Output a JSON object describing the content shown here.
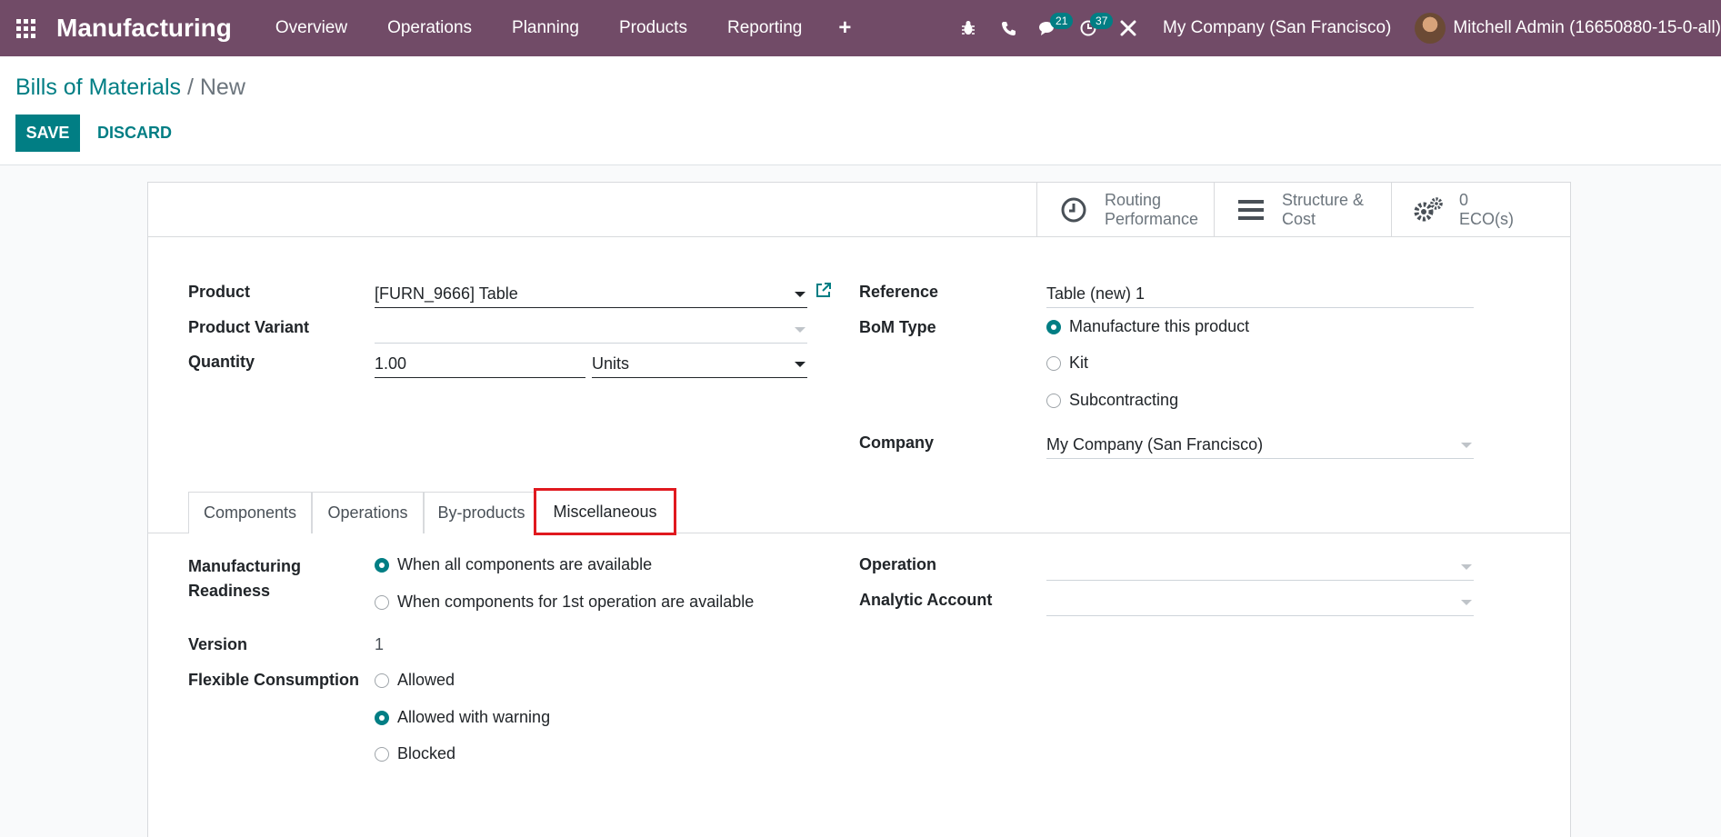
{
  "navbar": {
    "brand": "Manufacturing",
    "menu": [
      "Overview",
      "Operations",
      "Planning",
      "Products",
      "Reporting"
    ],
    "plus": "+",
    "messages_count": "21",
    "activities_count": "37",
    "company": "My Company (San Francisco)",
    "user": "Mitchell Admin (16650880-15-0-all)",
    "icons": [
      "apps-icon",
      "bug-icon",
      "phone-icon",
      "chat-icon",
      "clock-icon",
      "tools-icon"
    ]
  },
  "breadcrumb": {
    "parent": "Bills of Materials",
    "separator": "/",
    "current": "New"
  },
  "buttons": {
    "save": "SAVE",
    "discard": "DISCARD"
  },
  "smart_buttons": [
    {
      "line1": "Routing",
      "line2": "Performance",
      "icon": "clock-icon"
    },
    {
      "line1": "Structure &",
      "line2": "Cost",
      "icon": "bars-icon"
    },
    {
      "line1": "0",
      "line2": "ECO(s)",
      "icon": "gears-icon"
    }
  ],
  "form": {
    "product_label": "Product",
    "product_value": "[FURN_9666] Table",
    "variant_label": "Product Variant",
    "variant_value": "",
    "quantity_label": "Quantity",
    "quantity_value": "1.00",
    "uom_value": "Units",
    "reference_label": "Reference",
    "reference_value": "Table (new) 1",
    "bom_type_label": "BoM Type",
    "bom_types": [
      "Manufacture this product",
      "Kit",
      "Subcontracting"
    ],
    "bom_type_selected": "Manufacture this product",
    "company_label": "Company",
    "company_value": "My Company (San Francisco)"
  },
  "tabs": [
    "Components",
    "Operations",
    "By-products",
    "Miscellaneous"
  ],
  "active_tab": "Miscellaneous",
  "misc": {
    "readiness_label_1": "Manufacturing",
    "readiness_label_2": "Readiness",
    "readiness_options": [
      "When all components are available",
      "When components for 1st operation are available"
    ],
    "readiness_selected": "When all components are available",
    "version_label": "Version",
    "version_value": "1",
    "flex_label": "Flexible Consumption",
    "flex_options": [
      "Allowed",
      "Allowed with warning",
      "Blocked"
    ],
    "flex_selected": "Allowed with warning",
    "operation_label": "Operation",
    "operation_value": "",
    "analytic_label": "Analytic Account",
    "analytic_value": ""
  },
  "colors": {
    "navbar": "#714b67",
    "primary": "#017e84",
    "highlight": "#e0191f"
  }
}
